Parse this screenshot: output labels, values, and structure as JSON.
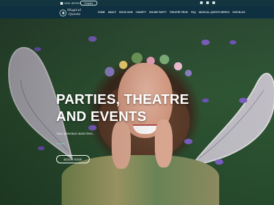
{
  "topbar": {
    "phone": "0161 4875XX",
    "enquire_label": "Enquire",
    "socials": [
      "facebook-icon",
      "instagram-icon",
      "youtube-icon"
    ]
  },
  "brand": {
    "line1": "Magical",
    "line2": "Quests"
  },
  "nav": {
    "items": [
      "HOME",
      "ABOUT",
      "BOOK NOW",
      "CHARITY",
      "ONLINE PARTY",
      "THEATRE PROD",
      "FAQ",
      "MAGICAL QUESTS MERCH",
      "OUR BLOG"
    ],
    "active": "HOME"
  },
  "hero": {
    "title_line1": "PARTIES, THEATRE",
    "title_line2": "AND EVENTS",
    "subtitle": "Your adventure starts here...",
    "cta_label": "BOOK NOW"
  },
  "colors": {
    "header_bg": "#0f3040",
    "topbar_bg": "#12353f",
    "accent": "#7ec9b8"
  }
}
